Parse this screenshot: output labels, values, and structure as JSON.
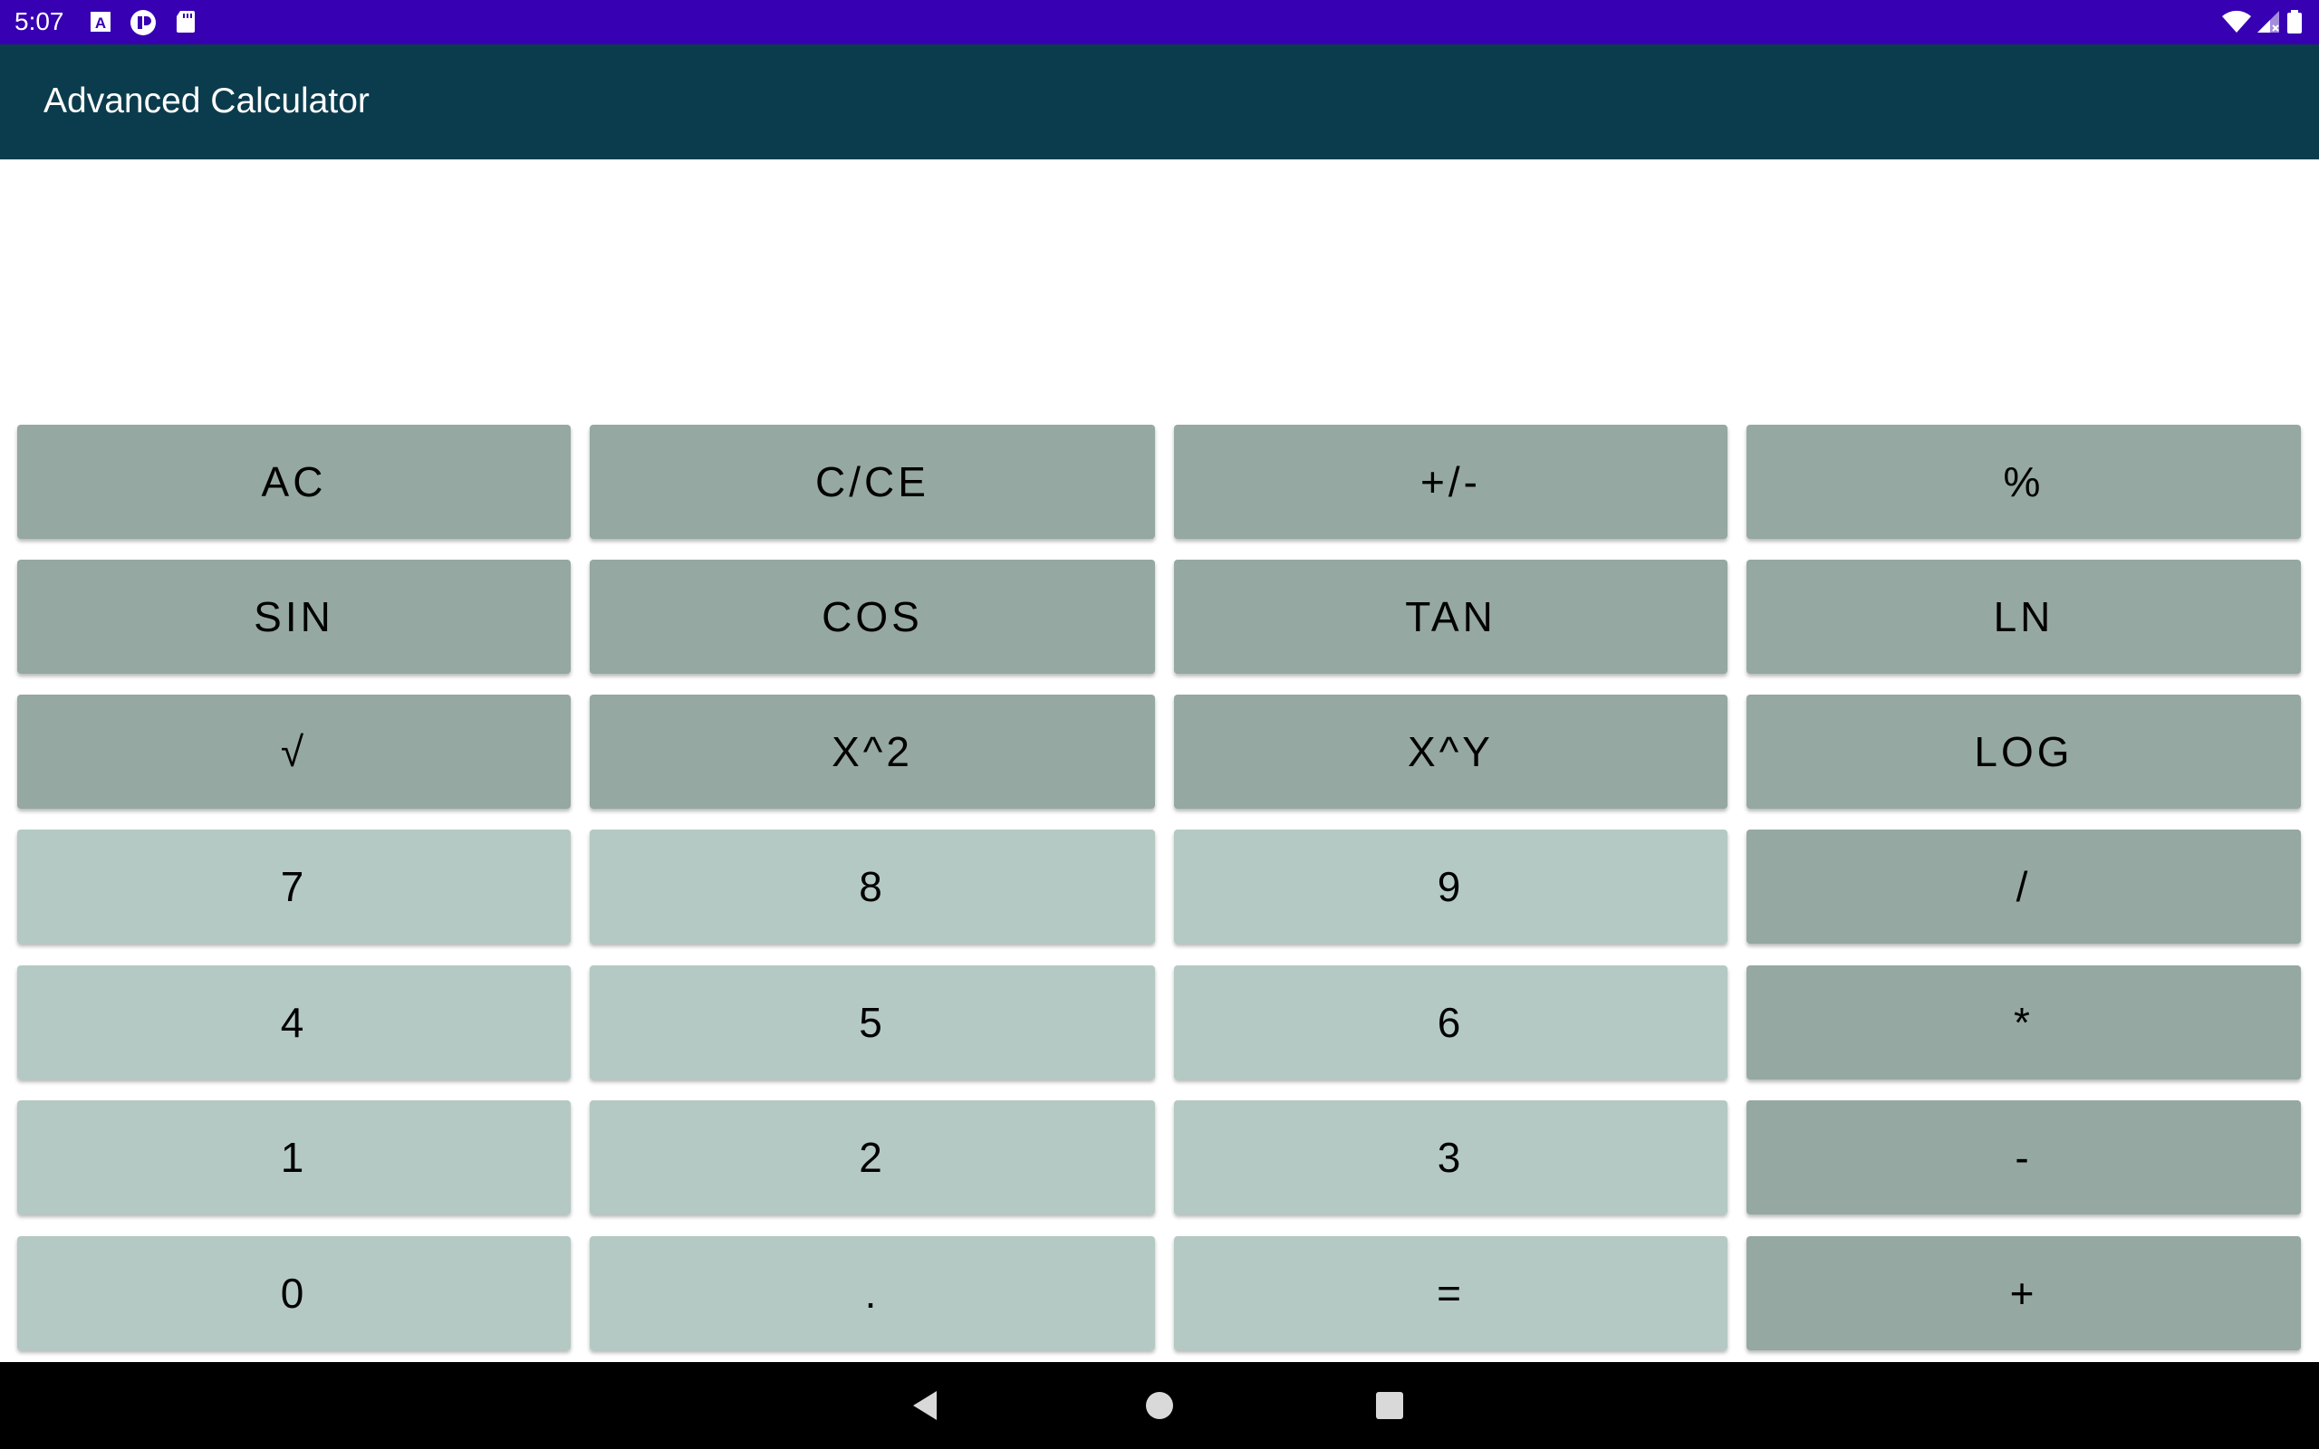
{
  "status_bar": {
    "time": "5:07",
    "left_icons": [
      "text-a-icon",
      "app-icon",
      "sd-card-icon"
    ],
    "right_icons": [
      "wifi-icon",
      "signal-icon",
      "battery-icon"
    ],
    "background": "#3700b3"
  },
  "app_bar": {
    "title": "Advanced Calculator",
    "background": "#0b3c4d"
  },
  "display": {
    "value": ""
  },
  "keypad": {
    "function_color": "#95a8a1",
    "number_color": "#b4c9c3",
    "rows": [
      [
        {
          "label": "AC",
          "kind": "fn"
        },
        {
          "label": "C/CE",
          "kind": "fn"
        },
        {
          "label": "+/-",
          "kind": "fn"
        },
        {
          "label": "%",
          "kind": "fn"
        }
      ],
      [
        {
          "label": "SIN",
          "kind": "fn"
        },
        {
          "label": "COS",
          "kind": "fn"
        },
        {
          "label": "TAN",
          "kind": "fn"
        },
        {
          "label": "LN",
          "kind": "fn"
        }
      ],
      [
        {
          "label": "√",
          "kind": "fn"
        },
        {
          "label": "X^2",
          "kind": "fn"
        },
        {
          "label": "X^Y",
          "kind": "fn"
        },
        {
          "label": "LOG",
          "kind": "fn"
        }
      ],
      [
        {
          "label": "7",
          "kind": "num"
        },
        {
          "label": "8",
          "kind": "num"
        },
        {
          "label": "9",
          "kind": "num"
        },
        {
          "label": "/",
          "kind": "fn"
        }
      ],
      [
        {
          "label": "4",
          "kind": "num"
        },
        {
          "label": "5",
          "kind": "num"
        },
        {
          "label": "6",
          "kind": "num"
        },
        {
          "label": "*",
          "kind": "fn"
        }
      ],
      [
        {
          "label": "1",
          "kind": "num"
        },
        {
          "label": "2",
          "kind": "num"
        },
        {
          "label": "3",
          "kind": "num"
        },
        {
          "label": "-",
          "kind": "fn"
        }
      ],
      [
        {
          "label": "0",
          "kind": "num"
        },
        {
          "label": ".",
          "kind": "num"
        },
        {
          "label": "=",
          "kind": "num"
        },
        {
          "label": "+",
          "kind": "fn"
        }
      ]
    ]
  },
  "nav_bar": {
    "buttons": [
      "back-icon",
      "home-icon",
      "recents-icon"
    ]
  }
}
